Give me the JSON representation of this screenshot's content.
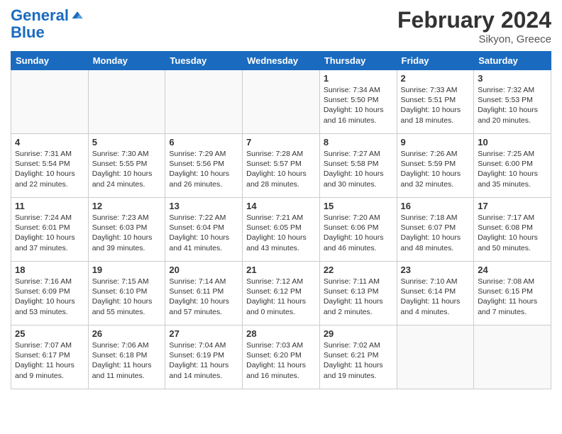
{
  "header": {
    "logo_line1": "General",
    "logo_line2": "Blue",
    "month_title": "February 2024",
    "location": "Sikyon, Greece"
  },
  "days_of_week": [
    "Sunday",
    "Monday",
    "Tuesday",
    "Wednesday",
    "Thursday",
    "Friday",
    "Saturday"
  ],
  "weeks": [
    [
      {
        "day": "",
        "sunrise": "",
        "sunset": "",
        "daylight": ""
      },
      {
        "day": "",
        "sunrise": "",
        "sunset": "",
        "daylight": ""
      },
      {
        "day": "",
        "sunrise": "",
        "sunset": "",
        "daylight": ""
      },
      {
        "day": "",
        "sunrise": "",
        "sunset": "",
        "daylight": ""
      },
      {
        "day": "1",
        "sunrise": "Sunrise: 7:34 AM",
        "sunset": "Sunset: 5:50 PM",
        "daylight": "Daylight: 10 hours and 16 minutes."
      },
      {
        "day": "2",
        "sunrise": "Sunrise: 7:33 AM",
        "sunset": "Sunset: 5:51 PM",
        "daylight": "Daylight: 10 hours and 18 minutes."
      },
      {
        "day": "3",
        "sunrise": "Sunrise: 7:32 AM",
        "sunset": "Sunset: 5:53 PM",
        "daylight": "Daylight: 10 hours and 20 minutes."
      }
    ],
    [
      {
        "day": "4",
        "sunrise": "Sunrise: 7:31 AM",
        "sunset": "Sunset: 5:54 PM",
        "daylight": "Daylight: 10 hours and 22 minutes."
      },
      {
        "day": "5",
        "sunrise": "Sunrise: 7:30 AM",
        "sunset": "Sunset: 5:55 PM",
        "daylight": "Daylight: 10 hours and 24 minutes."
      },
      {
        "day": "6",
        "sunrise": "Sunrise: 7:29 AM",
        "sunset": "Sunset: 5:56 PM",
        "daylight": "Daylight: 10 hours and 26 minutes."
      },
      {
        "day": "7",
        "sunrise": "Sunrise: 7:28 AM",
        "sunset": "Sunset: 5:57 PM",
        "daylight": "Daylight: 10 hours and 28 minutes."
      },
      {
        "day": "8",
        "sunrise": "Sunrise: 7:27 AM",
        "sunset": "Sunset: 5:58 PM",
        "daylight": "Daylight: 10 hours and 30 minutes."
      },
      {
        "day": "9",
        "sunrise": "Sunrise: 7:26 AM",
        "sunset": "Sunset: 5:59 PM",
        "daylight": "Daylight: 10 hours and 32 minutes."
      },
      {
        "day": "10",
        "sunrise": "Sunrise: 7:25 AM",
        "sunset": "Sunset: 6:00 PM",
        "daylight": "Daylight: 10 hours and 35 minutes."
      }
    ],
    [
      {
        "day": "11",
        "sunrise": "Sunrise: 7:24 AM",
        "sunset": "Sunset: 6:01 PM",
        "daylight": "Daylight: 10 hours and 37 minutes."
      },
      {
        "day": "12",
        "sunrise": "Sunrise: 7:23 AM",
        "sunset": "Sunset: 6:03 PM",
        "daylight": "Daylight: 10 hours and 39 minutes."
      },
      {
        "day": "13",
        "sunrise": "Sunrise: 7:22 AM",
        "sunset": "Sunset: 6:04 PM",
        "daylight": "Daylight: 10 hours and 41 minutes."
      },
      {
        "day": "14",
        "sunrise": "Sunrise: 7:21 AM",
        "sunset": "Sunset: 6:05 PM",
        "daylight": "Daylight: 10 hours and 43 minutes."
      },
      {
        "day": "15",
        "sunrise": "Sunrise: 7:20 AM",
        "sunset": "Sunset: 6:06 PM",
        "daylight": "Daylight: 10 hours and 46 minutes."
      },
      {
        "day": "16",
        "sunrise": "Sunrise: 7:18 AM",
        "sunset": "Sunset: 6:07 PM",
        "daylight": "Daylight: 10 hours and 48 minutes."
      },
      {
        "day": "17",
        "sunrise": "Sunrise: 7:17 AM",
        "sunset": "Sunset: 6:08 PM",
        "daylight": "Daylight: 10 hours and 50 minutes."
      }
    ],
    [
      {
        "day": "18",
        "sunrise": "Sunrise: 7:16 AM",
        "sunset": "Sunset: 6:09 PM",
        "daylight": "Daylight: 10 hours and 53 minutes."
      },
      {
        "day": "19",
        "sunrise": "Sunrise: 7:15 AM",
        "sunset": "Sunset: 6:10 PM",
        "daylight": "Daylight: 10 hours and 55 minutes."
      },
      {
        "day": "20",
        "sunrise": "Sunrise: 7:14 AM",
        "sunset": "Sunset: 6:11 PM",
        "daylight": "Daylight: 10 hours and 57 minutes."
      },
      {
        "day": "21",
        "sunrise": "Sunrise: 7:12 AM",
        "sunset": "Sunset: 6:12 PM",
        "daylight": "Daylight: 11 hours and 0 minutes."
      },
      {
        "day": "22",
        "sunrise": "Sunrise: 7:11 AM",
        "sunset": "Sunset: 6:13 PM",
        "daylight": "Daylight: 11 hours and 2 minutes."
      },
      {
        "day": "23",
        "sunrise": "Sunrise: 7:10 AM",
        "sunset": "Sunset: 6:14 PM",
        "daylight": "Daylight: 11 hours and 4 minutes."
      },
      {
        "day": "24",
        "sunrise": "Sunrise: 7:08 AM",
        "sunset": "Sunset: 6:15 PM",
        "daylight": "Daylight: 11 hours and 7 minutes."
      }
    ],
    [
      {
        "day": "25",
        "sunrise": "Sunrise: 7:07 AM",
        "sunset": "Sunset: 6:17 PM",
        "daylight": "Daylight: 11 hours and 9 minutes."
      },
      {
        "day": "26",
        "sunrise": "Sunrise: 7:06 AM",
        "sunset": "Sunset: 6:18 PM",
        "daylight": "Daylight: 11 hours and 11 minutes."
      },
      {
        "day": "27",
        "sunrise": "Sunrise: 7:04 AM",
        "sunset": "Sunset: 6:19 PM",
        "daylight": "Daylight: 11 hours and 14 minutes."
      },
      {
        "day": "28",
        "sunrise": "Sunrise: 7:03 AM",
        "sunset": "Sunset: 6:20 PM",
        "daylight": "Daylight: 11 hours and 16 minutes."
      },
      {
        "day": "29",
        "sunrise": "Sunrise: 7:02 AM",
        "sunset": "Sunset: 6:21 PM",
        "daylight": "Daylight: 11 hours and 19 minutes."
      },
      {
        "day": "",
        "sunrise": "",
        "sunset": "",
        "daylight": ""
      },
      {
        "day": "",
        "sunrise": "",
        "sunset": "",
        "daylight": ""
      }
    ]
  ]
}
